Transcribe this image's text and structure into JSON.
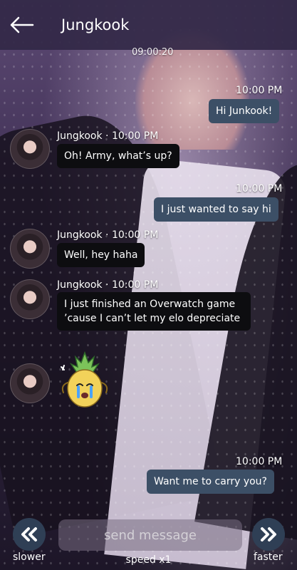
{
  "header": {
    "title": "Jungkook",
    "back_icon": "arrow-left-icon"
  },
  "partially_hidden_timestamp": "09:00:20",
  "messages": [
    {
      "dir": "out",
      "time": "10:00 PM",
      "text": "Hi Junkook!"
    },
    {
      "dir": "in",
      "sender": "Jungkook",
      "time": "10:00 PM",
      "text": "Oh! Army, what’s up?"
    },
    {
      "dir": "out",
      "time": "10:00 PM",
      "text": "I just wanted to say hi"
    },
    {
      "dir": "in",
      "sender": "Jungkook",
      "time": "10:00 PM",
      "text": "Well, hey haha"
    },
    {
      "dir": "in",
      "sender": "Jungkook",
      "time": "10:00 PM",
      "text": "I just finished an Overwatch game ’cause I can’t let my elo depreciate"
    },
    {
      "dir": "in",
      "sticker": "crying-pineapple-sticker"
    },
    {
      "dir": "out",
      "time": "10:00 PM",
      "text": "Want me to carry you?"
    }
  ],
  "footer": {
    "placeholder": "send message",
    "slower_label": "slower",
    "faster_label": "faster",
    "speed_label": "speed x1"
  },
  "colors": {
    "header": "#32284a",
    "out_bubble": "#3c4f66",
    "in_bubble": "#0d0d10",
    "control": "#2f3f55"
  }
}
